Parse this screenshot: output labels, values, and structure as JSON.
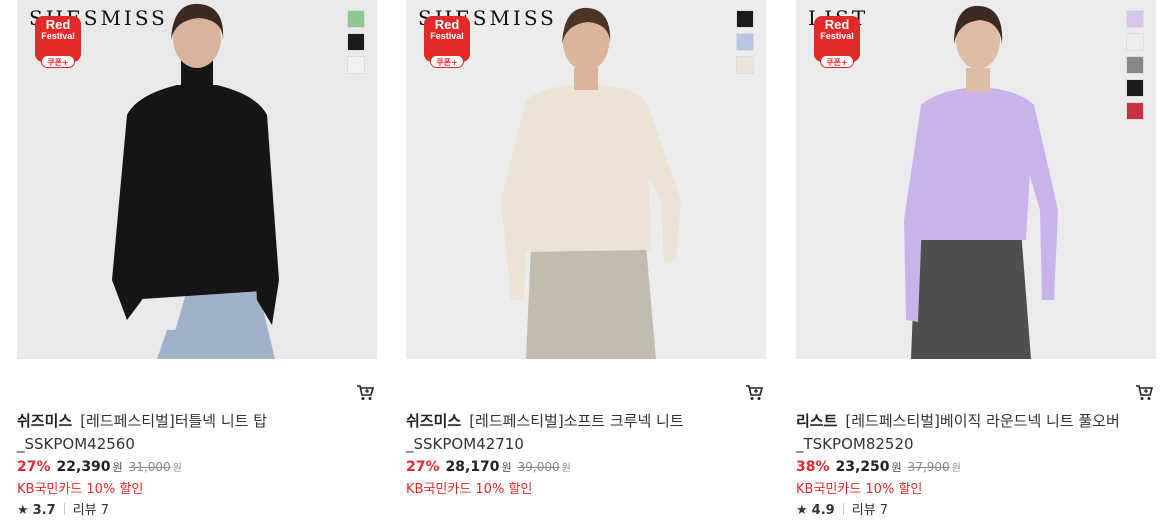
{
  "products": [
    {
      "brand_logo": "SHESMISS",
      "badge": {
        "line1": "Red",
        "line2": "Festival",
        "line3": "쿠폰+"
      },
      "swatches": [
        "#8fc792",
        "#1b1b1b",
        "#f1f1f1"
      ],
      "bg": "#e9e9ea",
      "sweater": "#151515",
      "pants": "#9fb2c8",
      "brand": "쉬즈미스",
      "name_line1": "[레드페스티벌]터틀넥 니트 탑",
      "name_line2": "_SSKPOM42560",
      "discount": "27%",
      "price": "22,390",
      "won": "원",
      "original_price": "31,000",
      "card_discount": "KB국민카드 10% 할인",
      "rating": "3.7",
      "reviews": "리뷰 7"
    },
    {
      "brand_logo": "SHESMISS",
      "badge": {
        "line1": "Red",
        "line2": "Festival",
        "line3": "쿠폰+"
      },
      "swatches": [
        "#1b1b1b",
        "#b9c6e2",
        "#ece4d9"
      ],
      "bg": "#ececec",
      "sweater": "#ece3d4",
      "pants": "#c2bcae",
      "brand": "쉬즈미스",
      "name_line1": "[레드페스티벌]소프트 크루넥 니트",
      "name_line2": "_SSKPOM42710",
      "discount": "27%",
      "price": "28,170",
      "won": "원",
      "original_price": "39,000",
      "card_discount": "KB국민카드 10% 할인",
      "rating": null,
      "reviews": null
    },
    {
      "brand_logo": "LIST",
      "badge": {
        "line1": "Red",
        "line2": "Festival",
        "line3": "쿠폰+"
      },
      "swatches": [
        "#d7c5ee",
        "#ececec",
        "#888888",
        "#1b1b1b",
        "#c9323f"
      ],
      "bg": "#ebebee",
      "sweater": "#c9b3ea",
      "pants": "#4e4f50",
      "brand": "리스트",
      "name_line1": "[레드페스티벌]베이직 라운드넥 니트 풀오버",
      "name_line2": "_TSKPOM82520",
      "discount": "38%",
      "price": "23,250",
      "won": "원",
      "original_price": "37,900",
      "card_discount": "KB국민카드 10% 할인",
      "rating": "4.9",
      "reviews": "리뷰 7"
    }
  ]
}
